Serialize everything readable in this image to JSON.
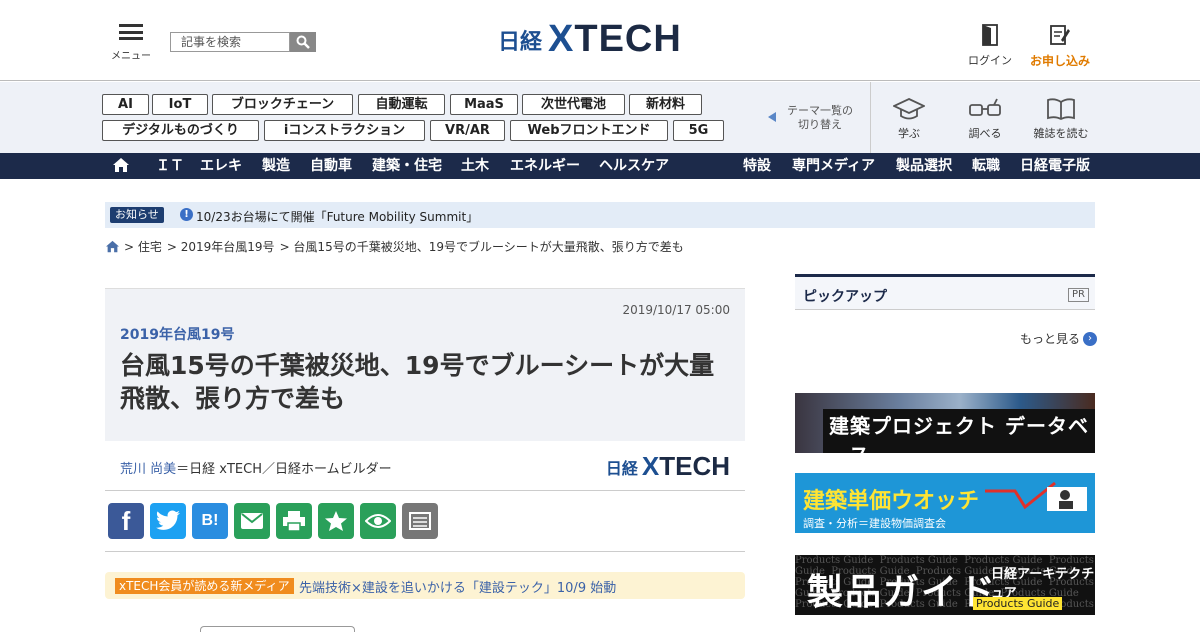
{
  "header": {
    "menu_label": "メニュー",
    "search_placeholder": "記事を検索",
    "logo_nikkei": "日経",
    "logo_x": "X",
    "logo_tech": "TECH",
    "login_label": "ログイン",
    "signup_label": "お申し込み",
    "signup_color": "#e07b00"
  },
  "themes": {
    "row1": [
      "AI",
      "IoT",
      "ブロックチェーン",
      "自動運転",
      "MaaS",
      "次世代電池",
      "新材料"
    ],
    "row2": [
      "デジタルものづくり",
      "iコンストラクション",
      "VR/AR",
      "Webフロントエンド",
      "5G"
    ],
    "switch_label_1": "テーマ一覧の",
    "switch_label_2": "切り替え",
    "learn_label": "学ぶ",
    "research_label": "調べる",
    "magazine_label": "雑誌を読む"
  },
  "nav": {
    "left": [
      "ＩＴ",
      "エレキ",
      "製造",
      "自動車",
      "建築・住宅",
      "土木",
      "エネルギー",
      "ヘルスケア"
    ],
    "right": [
      "特設",
      "専門メディア",
      "製品選択",
      "転職",
      "日経電子版"
    ],
    "bg_color": "#1c2a4a"
  },
  "notice": {
    "badge": "お知らせ",
    "text": "10/23お台場にて開催「Future Mobility Summit」"
  },
  "breadcrumb": {
    "items": [
      "> 住宅",
      "> 2019年台風19号",
      "> 台風15号の千葉被災地、19号でブルーシートが大量飛散、張り方で差も"
    ]
  },
  "article": {
    "date": "2019/10/17 05:00",
    "series": "2019年台風19号",
    "title": "台風15号の千葉被災地、19号でブルーシートが大量飛散、張り方で差も",
    "author_name": "荒川 尚美",
    "author_affil": "＝日経 xTECH／日経ホームビルダー",
    "logo_nikkei": "日経",
    "logo_x": "X",
    "logo_tech": "TECH"
  },
  "share": {
    "facebook_icon": "f",
    "hatena_icon": "B!"
  },
  "promo": {
    "badge": "xTECH会員が読める新メディア",
    "text": "先端技術×建設を追いかける「建設テック」10/9 始動"
  },
  "sidebar": {
    "pickup_label": "ピックアップ",
    "pr_label": "PR",
    "more_label": "もっと見る",
    "banner1_title": "建築プロジェクト データベース",
    "banner2_title": "建築単価ウオッチ",
    "banner2_sub": "調査・分析＝建設物価調査会",
    "banner3_title": "製品ガイド",
    "banner3_brand": "日経アーキテクチュア",
    "banner3_sub": "Products Guide"
  }
}
